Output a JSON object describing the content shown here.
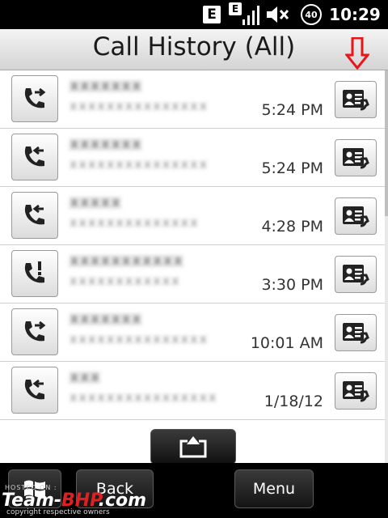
{
  "status_bar": {
    "network_badge_1": "E",
    "network_badge_2": "E",
    "battery_level": "40",
    "clock": "10:29",
    "icons": [
      "network-e-icon",
      "signal-strength-icon",
      "volume-mute-icon",
      "battery-icon"
    ]
  },
  "header": {
    "title": "Call History (All)"
  },
  "calls": [
    {
      "type": "outgoing",
      "icon": "outgoing-call-icon",
      "name": "xxxxxxx",
      "number": "xxxxxxxxxxxxxxx",
      "time": "5:24 PM"
    },
    {
      "type": "incoming",
      "icon": "incoming-call-icon",
      "name": "xxxxxxx",
      "number": "xxxxxxxxxxxxxxx",
      "time": "5:24 PM"
    },
    {
      "type": "incoming",
      "icon": "incoming-call-icon",
      "name": "xxxxx",
      "number": "xxxxxxxxxxxxxx",
      "time": "4:28 PM"
    },
    {
      "type": "missed",
      "icon": "missed-call-icon",
      "name": "xxxxxxxxxxx",
      "number": "xxxxxxxxxxxx",
      "time": "3:30 PM"
    },
    {
      "type": "outgoing",
      "icon": "outgoing-call-icon",
      "name": "xxxxxxx",
      "number": "xxxxxxxxxxxxxxx",
      "time": "10:01 AM"
    },
    {
      "type": "incoming",
      "icon": "incoming-call-icon",
      "name": "xxx",
      "number": "xxxxxxxxxxxxxxxx",
      "time": "1/18/12"
    }
  ],
  "contact_card_icon": "contact-card-icon",
  "annotation": {
    "color": "#e8161b",
    "icon": "red-down-arrow-annotation"
  },
  "bottom": {
    "scroll_up_icon": "scroll-to-top-icon",
    "windows_icon": "windows-start-icon",
    "back_label": "Back",
    "menu_label": "Menu"
  },
  "watermark": {
    "line1": "HOSTED ON :",
    "brand_part1": "Team-",
    "brand_part2": "BHP",
    "brand_part3": ".com",
    "line3": "copyright respective owners"
  }
}
